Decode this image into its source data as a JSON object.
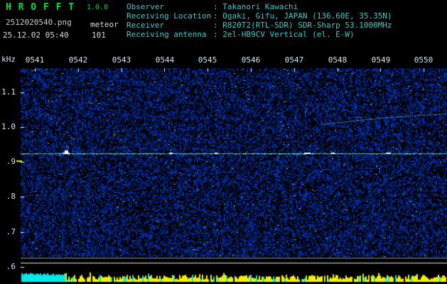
{
  "header": {
    "app_title": "H R O F F T",
    "version": "1.0.0",
    "filename": "2512020540.png",
    "mode": "meteor",
    "datetime": "25.12.02 05:40",
    "count": "101",
    "info": [
      {
        "label": "Observer",
        "value": ": Takanori Kawachi"
      },
      {
        "label": "Receiving Location",
        "value": ": Ogaki, Gifu, JAPAN (136.60E, 35.35N)"
      },
      {
        "label": "Receiver",
        "value": ": R820T2(RTL-SDR) SDR-Sharp 53.1000MHz"
      },
      {
        "label": "Receiving antenna",
        "value": ": 2el-HB9CV Vertical (el. E-W)"
      }
    ]
  },
  "axes": {
    "freq_unit": "kHz",
    "freq_ticks": [
      "1.1",
      "1.0",
      ".9",
      ".8",
      ".7",
      ".6"
    ],
    "time_ticks": [
      "0541",
      "0542",
      "0543",
      "0544",
      "0545",
      "0546",
      "0547",
      "0548",
      "0549",
      "0550"
    ]
  },
  "colors": {
    "title_green": "#00e033",
    "header_cyan": "#3fc8c8",
    "axis_text": "#d0e4f0",
    "noise_blue": "#0028a0",
    "carrier_cyan": "#8cebe6",
    "bar_yellow": "#f0f000",
    "bar_cyan": "#00e8e8",
    "marker_yellow": "#f0f000"
  }
}
